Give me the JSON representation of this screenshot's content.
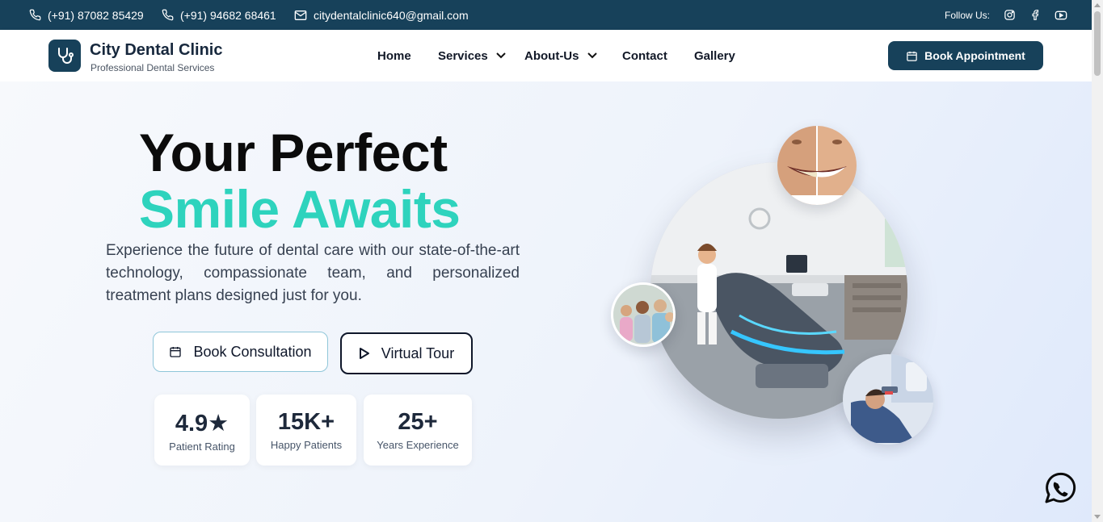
{
  "topbar": {
    "phone1": "(+91) 87082 85429",
    "phone2": "(+91) 94682 68461",
    "email": "citydentalclinic640@gmail.com",
    "follow_label": "Follow Us:",
    "social_icons": [
      "instagram-icon",
      "facebook-icon",
      "youtube-icon"
    ]
  },
  "header": {
    "brand": "City Dental Clinic",
    "tagline": "Professional Dental Services",
    "nav": {
      "home": "Home",
      "services": "Services",
      "about": "About-Us",
      "contact": "Contact",
      "gallery": "Gallery"
    },
    "cta": "Book Appointment"
  },
  "hero": {
    "title_line1": "Your Perfect",
    "title_line2": "Smile Awaits",
    "description": "Experience the future of dental care with our state-of-the-art technology, compassionate team, and personalized treatment plans designed just for you.",
    "primary_button": "Book Consultation",
    "secondary_button": "Virtual Tour",
    "stats": [
      {
        "value": "4.9★",
        "label": "Patient Rating"
      },
      {
        "value": "15K+",
        "label": "Happy Patients"
      },
      {
        "value": "25+",
        "label": "Years Experience"
      }
    ]
  },
  "colors": {
    "primary": "#17415a",
    "accent": "#2ed3bd",
    "text_dark": "#0b0b0b"
  }
}
